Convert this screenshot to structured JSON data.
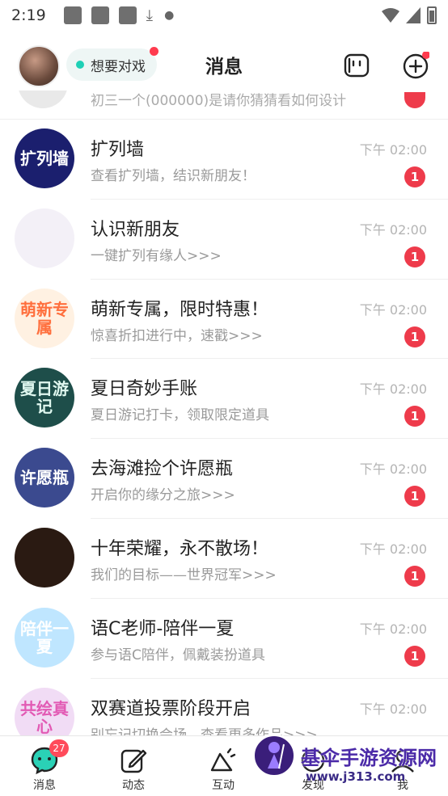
{
  "status_bar": {
    "time": "2:19"
  },
  "header": {
    "mode_label": "想要对戏",
    "title": "消息"
  },
  "partial_item": {
    "text": "初三一个(000000)是请你猜猜看如何设计"
  },
  "conversations": [
    {
      "name": "扩列墙",
      "preview": "查看扩列墙，结识新朋友！",
      "time": "下午 02:00",
      "badge": "1",
      "avatar_text": "扩列墙",
      "avatar_bg": "#1b1f6e",
      "avatar_fg": "#ffffff"
    },
    {
      "name": "认识新朋友",
      "preview": "一键扩列有缘人>>>",
      "time": "下午 02:00",
      "badge": "1",
      "avatar_text": "",
      "avatar_bg": "#f3f0f7",
      "avatar_fg": "#555555"
    },
    {
      "name": "萌新专属，限时特惠！",
      "preview": "惊喜折扣进行中，速戳>>>",
      "time": "下午 02:00",
      "badge": "1",
      "avatar_text": "萌新专属",
      "avatar_bg": "#fff1e2",
      "avatar_fg": "#ff6f3d"
    },
    {
      "name": "夏日奇妙手账",
      "preview": "夏日游记打卡，领取限定道具",
      "time": "下午 02:00",
      "badge": "1",
      "avatar_text": "夏日游记",
      "avatar_bg": "#1e4e4a",
      "avatar_fg": "#dff7ef"
    },
    {
      "name": "去海滩捡个许愿瓶",
      "preview": "开启你的缘分之旅>>>",
      "time": "下午 02:00",
      "badge": "1",
      "avatar_text": "许愿瓶",
      "avatar_bg": "#3b4a8f",
      "avatar_fg": "#ffffff"
    },
    {
      "name": "十年荣耀，永不散场！",
      "preview": "我们的目标——世界冠军>>>",
      "time": "下午 02:00",
      "badge": "1",
      "avatar_text": "",
      "avatar_bg": "#2a1a12",
      "avatar_fg": "#d6a54a"
    },
    {
      "name": "语C老师-陪伴一夏",
      "preview": "参与语C陪伴，佩戴装扮道具",
      "time": "下午 02:00",
      "badge": "1",
      "avatar_text": "陪伴一夏",
      "avatar_bg": "#bfe6ff",
      "avatar_fg": "#ffffff"
    },
    {
      "name": "双赛道投票阶段开启",
      "preview": "别忘记切换会场，查看更多作品>>>",
      "time": "下午 02:00",
      "badge": "",
      "avatar_text": "共绘真心",
      "avatar_bg": "#f1dcf5",
      "avatar_fg": "#e25ab4"
    }
  ],
  "bottom_nav": {
    "tabs": [
      {
        "label": "消息",
        "badge": "27"
      },
      {
        "label": "动态"
      },
      {
        "label": "互动"
      },
      {
        "label": "发现"
      },
      {
        "label": "我"
      }
    ]
  },
  "watermark": {
    "title": "基伞手游资源网",
    "url": "www.j313.com"
  },
  "colors": {
    "accent": "#1fd0b6",
    "badge": "#ee3b4b"
  }
}
